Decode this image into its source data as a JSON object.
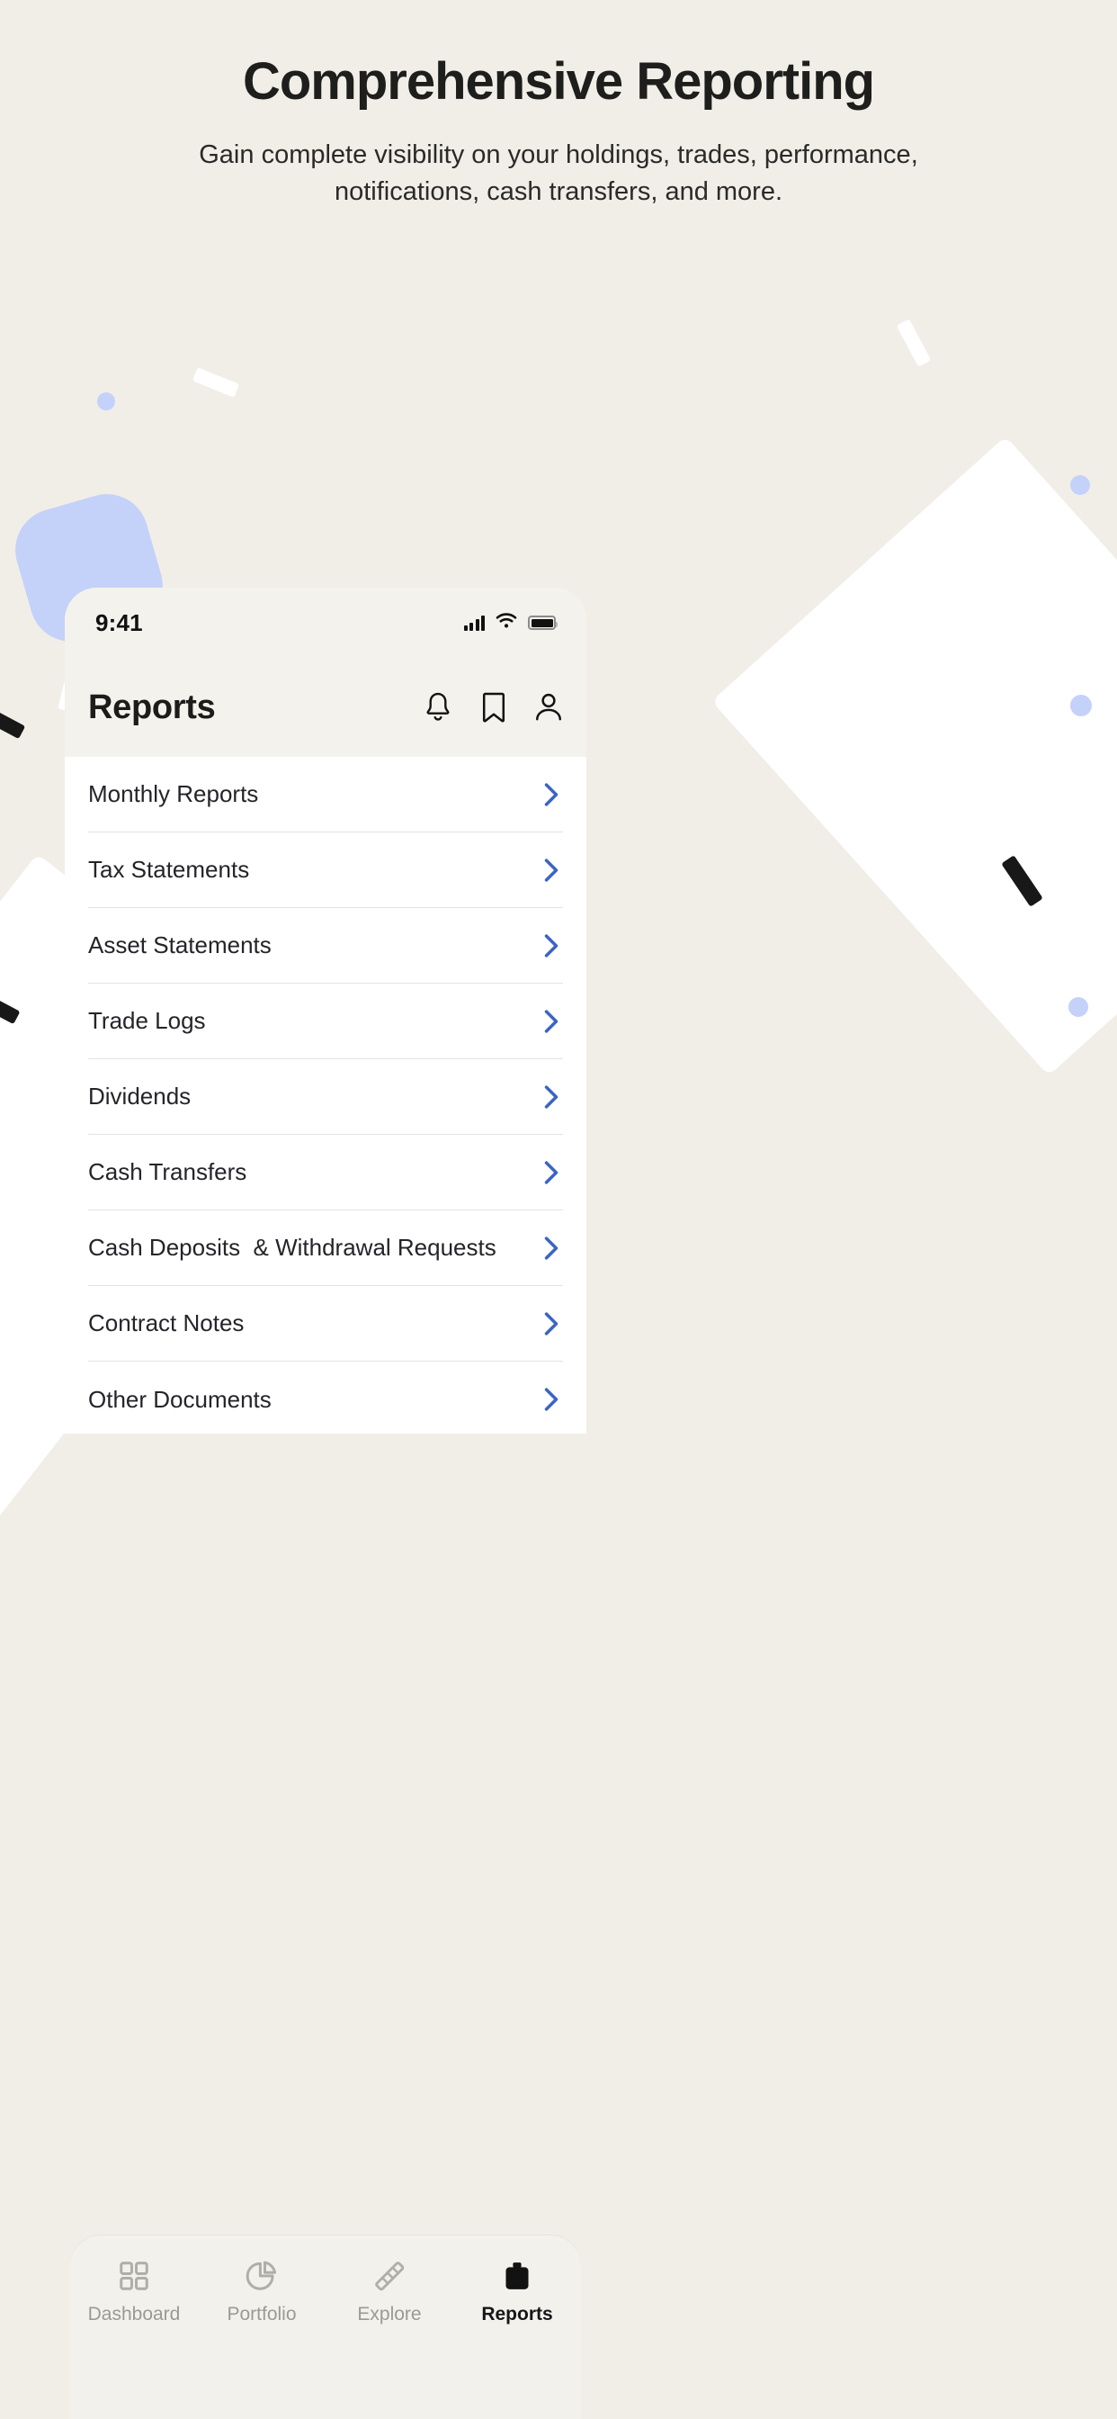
{
  "hero": {
    "title": "Comprehensive Reporting",
    "subtitle": "Gain complete visibility on your holdings, trades, performance, notifications, cash transfers, and more."
  },
  "colors": {
    "page_background": "#F1EEE8",
    "phone_background": "#FFFFFF",
    "phone_header": "#F4F2ED",
    "chevron_blue": "#3B64C4",
    "accent_lavender": "#C4D2FA",
    "divider": "#E3E3E1",
    "text_primary": "#1C1C1A",
    "tab_inactive": "#9A9A95"
  },
  "phone": {
    "status_bar": {
      "time": "9:41",
      "signal_icon": "cellular-signal-icon",
      "wifi_icon": "wifi-icon",
      "battery_icon": "battery-icon"
    },
    "app_bar": {
      "title": "Reports",
      "actions": [
        {
          "name": "notifications-bell-icon",
          "label": "Notifications"
        },
        {
          "name": "bookmark-icon",
          "label": "Bookmarks"
        },
        {
          "name": "profile-person-icon",
          "label": "Profile"
        }
      ]
    },
    "list": {
      "chevron_icon": "chevron-right-icon",
      "items": [
        {
          "label": "Monthly Reports"
        },
        {
          "label": "Tax Statements"
        },
        {
          "label": "Asset Statements"
        },
        {
          "label": "Trade Logs"
        },
        {
          "label": "Dividends"
        },
        {
          "label": "Cash Transfers"
        },
        {
          "label": "Cash Deposits  & Withdrawal Requests"
        },
        {
          "label": "Contract Notes"
        },
        {
          "label": "Other Documents"
        }
      ]
    },
    "tab_bar": {
      "tabs": [
        {
          "label": "Dashboard",
          "icon": "grid-icon",
          "active": false
        },
        {
          "label": "Portfolio",
          "icon": "pie-chart-icon",
          "active": false
        },
        {
          "label": "Explore",
          "icon": "telescope-icon",
          "active": false
        },
        {
          "label": "Reports",
          "icon": "briefcase-icon",
          "active": true
        }
      ]
    }
  }
}
